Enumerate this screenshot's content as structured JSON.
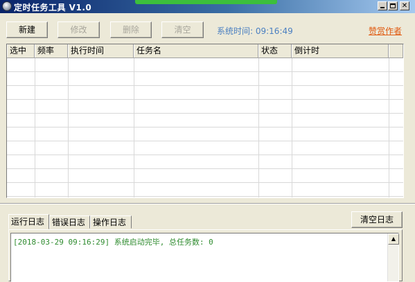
{
  "window": {
    "title": "定时任务工具 V1.0",
    "icon": "clock-icon",
    "controls": [
      "minimize-icon",
      "maximize-icon",
      "close-icon"
    ]
  },
  "toolbar": {
    "new_label": "新建",
    "edit_label": "修改",
    "delete_label": "删除",
    "clear_label": "清空",
    "system_time_label": "系统时间: 09:16:49",
    "sponsor_label": "赞赏作者"
  },
  "task_table": {
    "columns": [
      "选中",
      "频率",
      "执行时间",
      "任务名",
      "状态",
      "倒计时"
    ],
    "rows": []
  },
  "log": {
    "tabs": [
      "运行日志",
      "错误日志",
      "操作日志"
    ],
    "active_tab": "运行日志",
    "clear_button_label": "清空日志",
    "entries": [
      "[2018-03-29 09:16:29] 系统启动完毕, 总任务数: 0"
    ]
  },
  "colors": {
    "titlebar_start": "#0a246a",
    "system_time": "#4a7fc1",
    "sponsor_link": "#e05a10",
    "log_text": "#2e8b2e"
  }
}
